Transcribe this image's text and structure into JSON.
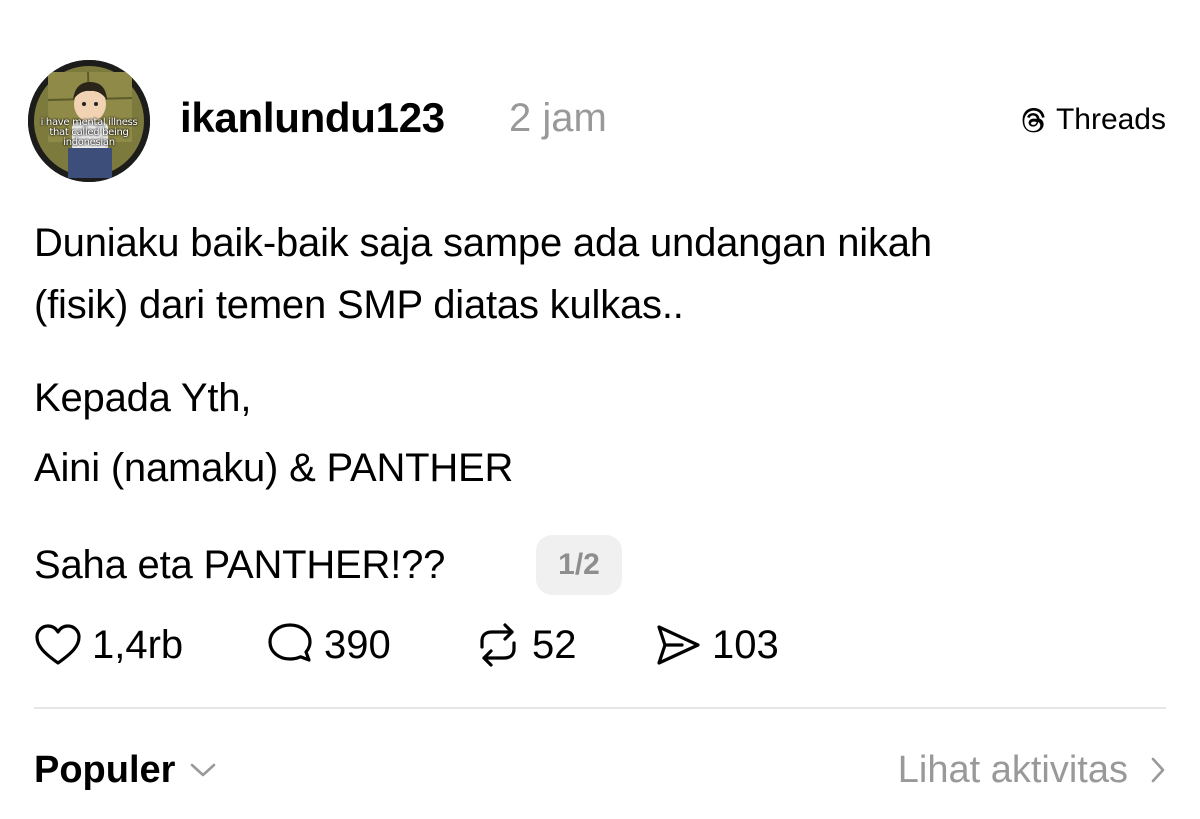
{
  "post": {
    "author": {
      "username": "ikanlundu123",
      "avatar_caption": "i have mental illness that called being indonesian"
    },
    "timestamp": "2 jam",
    "platform_badge": {
      "label": "Threads",
      "icon": "threads-logo-icon"
    },
    "body_lines": [
      "Duniaku baik-baik saja sampe ada undangan nikah",
      "(fisik) dari temen SMP diatas kulkas..",
      "Kepada Yth,",
      "Aini (namaku) & PANTHER",
      "Saha eta PANTHER!??"
    ],
    "page_indicator": "1/2",
    "actions": {
      "like": {
        "icon": "heart-icon",
        "count": "1,4rb"
      },
      "reply": {
        "icon": "speech-bubble-icon",
        "count": "390"
      },
      "repost": {
        "icon": "repost-icon",
        "count": "52"
      },
      "share": {
        "icon": "send-icon",
        "count": "103"
      }
    }
  },
  "footer": {
    "sort_label": "Populer",
    "sort_icon": "chevron-down-icon",
    "activity_link": "Lihat aktivitas",
    "activity_icon": "chevron-right-icon"
  },
  "colors": {
    "text": "#000000",
    "muted": "#999999",
    "divider": "#e6e6e6",
    "pill_bg": "#f0f0f0"
  }
}
